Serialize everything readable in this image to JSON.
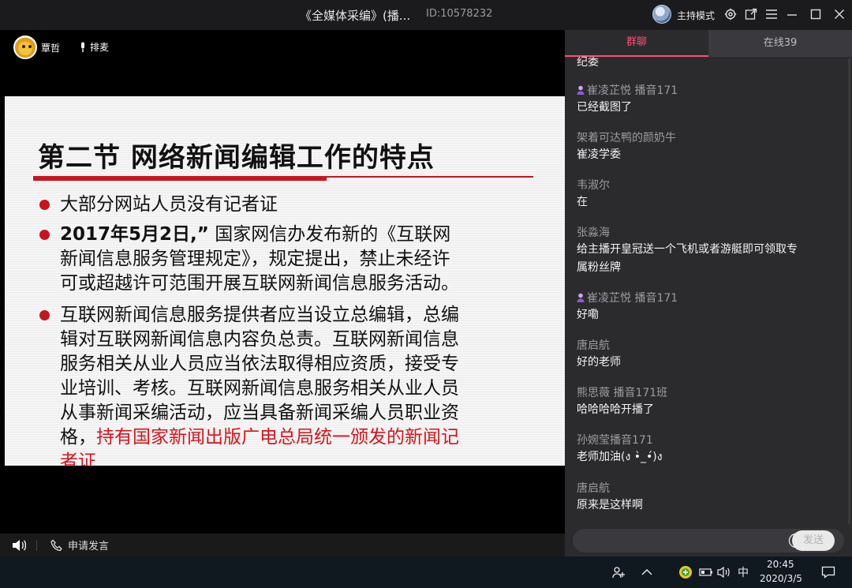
{
  "titlebar": {
    "title": "《全媒体采编》(播...",
    "room_id": "ID:10578232",
    "host_mode": "主持模式"
  },
  "video": {
    "teacher_name": "覃哲",
    "mic_queue_label": "排麦"
  },
  "slide": {
    "title": "第二节 网络新闻编辑工作的特点",
    "bullet1": "大部分网站人员没有记者证",
    "bullet2_bold": "2017年5月2日,”",
    "bullet2_line1": "国家网信办发布新的《互联网",
    "bullet2_line2": "新闻信息服务管理规定》，规定提出，禁止未经许",
    "bullet2_line3": "可或超越许可范围开展互联网新闻信息服务活动。",
    "bullet3_line1": "互联网新闻信息服务提供者应当设立总编辑，总编",
    "bullet3_line2": "辑对互联网新闻信息内容负总责。互联网新闻信息",
    "bullet3_line3": "服务相关从业人员应当依法取得相应资质，接受专",
    "bullet3_line4": "业培训、考核。互联网新闻信息服务相关从业人员",
    "bullet3_line5": "从事新闻采编活动，应当具备新闻采编人员职业资",
    "bullet3_line6a": "格，",
    "bullet3_line6b": "持有国家新闻出版广电总局统一颁发的新闻记",
    "bullet3_line7": "者证"
  },
  "controls": {
    "apply_speak": "申请发言"
  },
  "chat": {
    "tab_group": "群聊",
    "tab_online": "在线39",
    "messages": [
      {
        "name": "",
        "text": "纪委"
      },
      {
        "name": "崔凌芷悦 播音171",
        "text": "已经截图了",
        "teacher": true
      },
      {
        "name": "架着可达鸭的颜奶牛",
        "text": "崔凌学委"
      },
      {
        "name": "韦淑尔",
        "text": "在"
      },
      {
        "name": "张淼海",
        "text": "给主播开皇冠送一个飞机或者游艇即可领取专",
        "text2": "属粉丝牌"
      },
      {
        "name": "崔凌芷悦 播音171",
        "text": "好嘞",
        "teacher": true
      },
      {
        "name": "唐启航",
        "text": "好的老师"
      },
      {
        "name": "熊思薇 播音171班",
        "text": "哈哈哈哈开播了"
      },
      {
        "name": "孙婉莹播音171",
        "text": "老师加油(ง •̀_•́)ง"
      },
      {
        "name": "唐启航",
        "text": "原来是这样啊"
      }
    ],
    "send_label": "发送"
  },
  "taskbar": {
    "ime": "中",
    "time": "20:45",
    "date": "2020/3/5"
  },
  "colors": {
    "accent": "#ff4f73",
    "slide_red": "#c8151c"
  }
}
